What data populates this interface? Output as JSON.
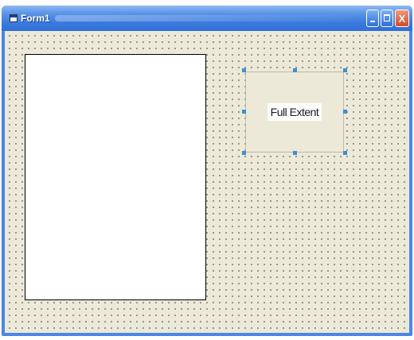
{
  "window": {
    "title": "Form1"
  },
  "caption_buttons": {
    "minimize_icon": "minimize-icon",
    "maximize_icon": "maximize-icon",
    "close_glyph": "X"
  },
  "form": {
    "picture_box": {
      "background": "#ffffff"
    },
    "command_button": {
      "caption": "Full Extent",
      "selected": true
    }
  },
  "colors": {
    "titlebar": "#3a78dc",
    "client_background": "#ece9d8",
    "selection_handle": "#3c8fd8",
    "close_button": "#d8451f"
  }
}
